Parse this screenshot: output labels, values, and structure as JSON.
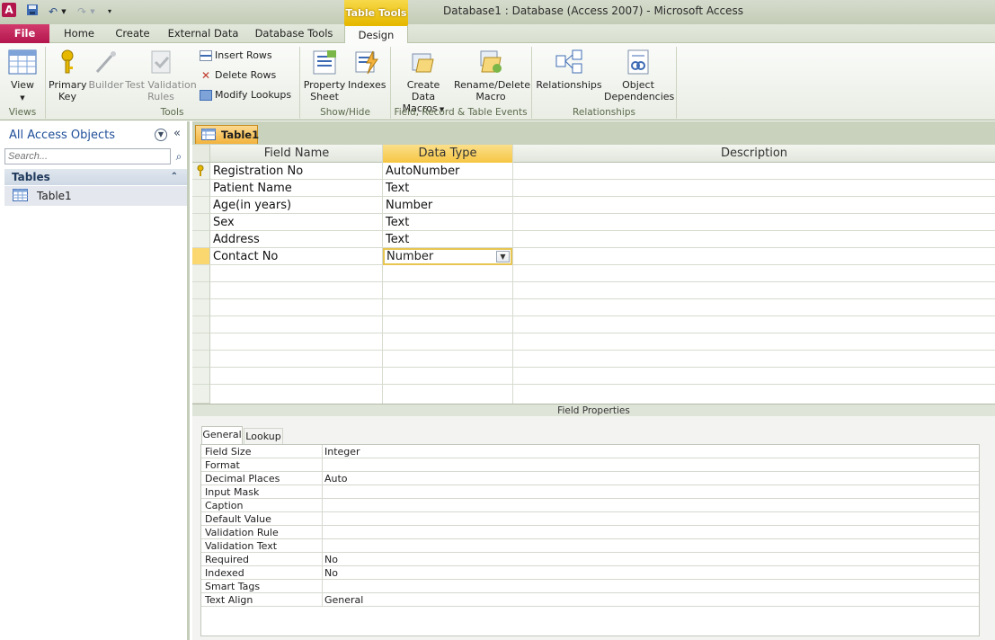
{
  "window": {
    "title": "Database1 : Database (Access 2007)  -  Microsoft Access",
    "context_tab": "Table Tools"
  },
  "tabs": [
    "File",
    "Home",
    "Create",
    "External Data",
    "Database Tools",
    "Design"
  ],
  "ribbon": {
    "views": {
      "view_label": "View",
      "group": "Views"
    },
    "tools": {
      "primary_key": [
        "Primary",
        "Key"
      ],
      "builder": "Builder",
      "test_rules": [
        "Test Validation",
        "Rules"
      ],
      "insert_rows": "Insert Rows",
      "delete_rows": "Delete Rows",
      "modify_lookups": "Modify Lookups",
      "group": "Tools"
    },
    "showhide": {
      "property_sheet": [
        "Property",
        "Sheet"
      ],
      "indexes": "Indexes",
      "group": "Show/Hide"
    },
    "events": {
      "create_macros": [
        "Create Data",
        "Macros"
      ],
      "rename_macro": [
        "Rename/Delete",
        "Macro"
      ],
      "group": "Field, Record & Table Events"
    },
    "relationships": {
      "relationships": "Relationships",
      "dependencies": [
        "Object",
        "Dependencies"
      ],
      "group": "Relationships"
    }
  },
  "nav": {
    "header": "All Access Objects",
    "search_placeholder": "Search...",
    "group": "Tables",
    "items": [
      "Table1"
    ]
  },
  "document_tab": "Table1",
  "design_grid": {
    "headers": [
      "Field Name",
      "Data Type",
      "Description"
    ],
    "rows": [
      {
        "field": "Registration No",
        "type": "AutoNumber",
        "description": ""
      },
      {
        "field": "Patient Name",
        "type": "Text",
        "description": ""
      },
      {
        "field": "Age(in years)",
        "type": "Number",
        "description": ""
      },
      {
        "field": "Sex",
        "type": "Text",
        "description": ""
      },
      {
        "field": "Address",
        "type": "Text",
        "description": ""
      },
      {
        "field": "Contact No",
        "type": "Number",
        "description": ""
      }
    ]
  },
  "field_properties": {
    "title": "Field Properties",
    "tabs": [
      "General",
      "Lookup"
    ],
    "rows": [
      {
        "name": "Field Size",
        "value": "Integer"
      },
      {
        "name": "Format",
        "value": ""
      },
      {
        "name": "Decimal Places",
        "value": "Auto"
      },
      {
        "name": "Input Mask",
        "value": ""
      },
      {
        "name": "Caption",
        "value": ""
      },
      {
        "name": "Default Value",
        "value": ""
      },
      {
        "name": "Validation Rule",
        "value": ""
      },
      {
        "name": "Validation Text",
        "value": ""
      },
      {
        "name": "Required",
        "value": "No"
      },
      {
        "name": "Indexed",
        "value": "No"
      },
      {
        "name": "Smart Tags",
        "value": ""
      },
      {
        "name": "Text Align",
        "value": "General"
      }
    ]
  },
  "colors": {
    "file_tab": "#b3164d",
    "context_tab": "#e6b800",
    "selection": "#f6c543"
  }
}
